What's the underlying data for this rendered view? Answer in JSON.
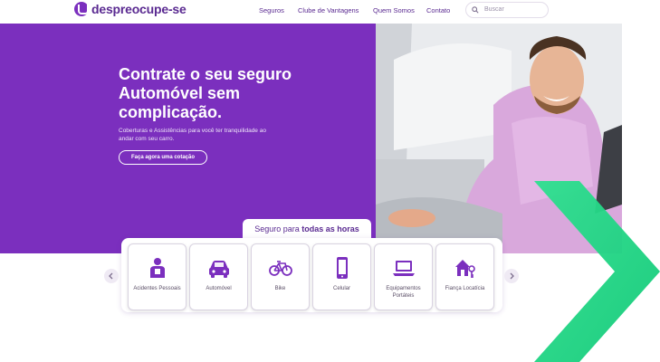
{
  "brand": {
    "name": "despreocupe-se",
    "accent": "#7b2fbe",
    "accent_dark": "#5a2a91",
    "chevron_green": "#2ee08f"
  },
  "nav": {
    "items": [
      "Seguros",
      "Clube de Vantagens",
      "Quem Somos",
      "Contato"
    ]
  },
  "search": {
    "placeholder": "Buscar"
  },
  "hero": {
    "title": "Contrate o seu seguro Automóvel sem complicação.",
    "subtitle": "Coberturas e Assistências para você ter tranquilidade ao andar com seu carro.",
    "cta_label": "Faça agora uma cotação"
  },
  "strip": {
    "prefix": "Seguro para",
    "emphasis": "todas as horas"
  },
  "categories": [
    {
      "label": "Acidentes Pessoais",
      "icon": "person-injury-icon"
    },
    {
      "label": "Automóvel",
      "icon": "car-icon"
    },
    {
      "label": "Bike",
      "icon": "bicycle-icon"
    },
    {
      "label": "Celular",
      "icon": "smartphone-icon"
    },
    {
      "label": "Equipamentos Portáteis",
      "icon": "laptop-icon"
    },
    {
      "label": "Fiança Locatícia",
      "icon": "house-key-icon"
    }
  ]
}
